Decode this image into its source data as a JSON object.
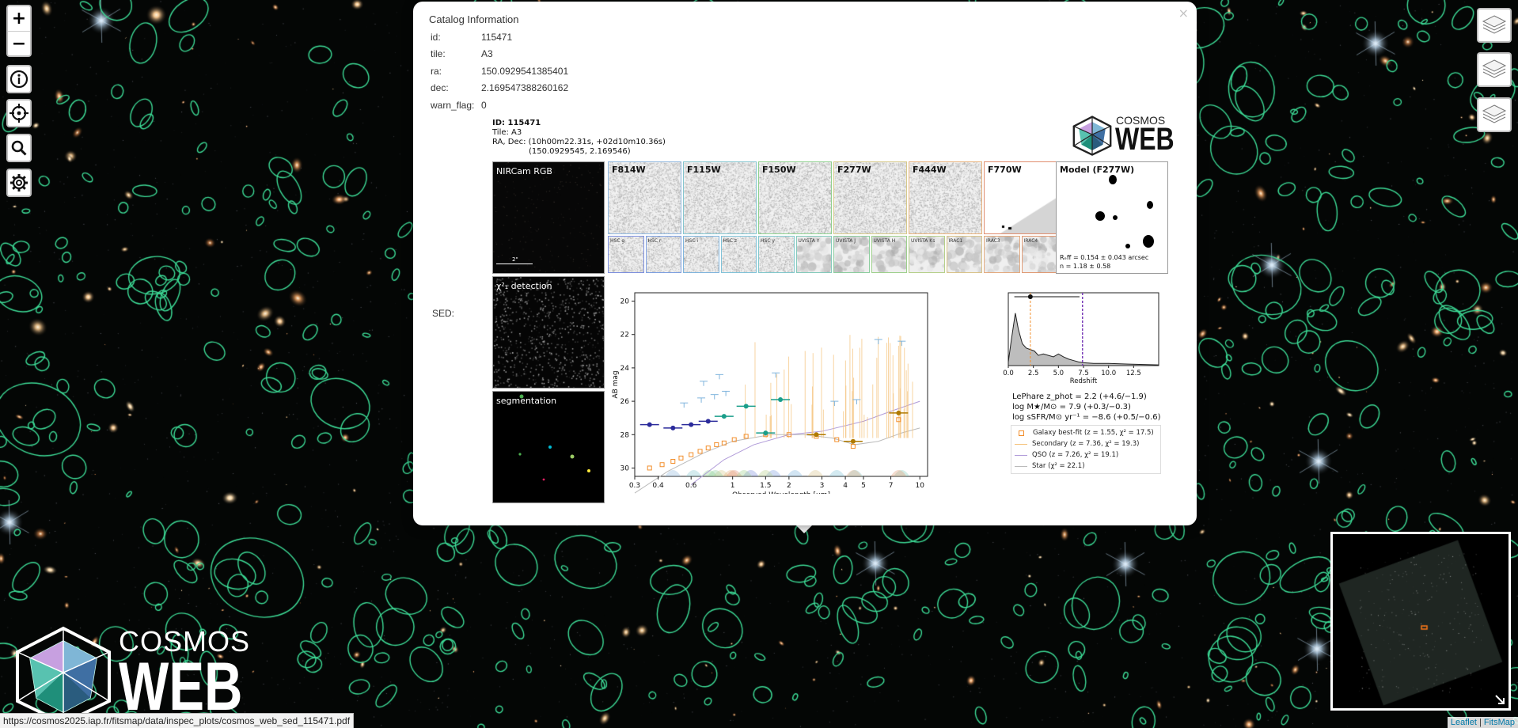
{
  "map": {
    "zoom_in": "+",
    "zoom_out": "−",
    "status_url": "https://cosmos2025.iap.fr/fitsmap/data/inspec_plots/cosmos_web_sed_115471.pdf",
    "attribution_sep": "|",
    "attribution_leaflet": "Leaflet",
    "attribution_fitsmap": "FitsMap",
    "logo_top": "COSMOS",
    "logo_bottom": "WEB"
  },
  "popup": {
    "title": "Catalog Information",
    "fields": [
      {
        "key": "id:",
        "value": "115471"
      },
      {
        "key": "tile:",
        "value": "A3"
      },
      {
        "key": "ra:",
        "value": "150.0929541385401"
      },
      {
        "key": "dec:",
        "value": "2.169547388260162"
      },
      {
        "key": "warn_flag:",
        "value": "0"
      }
    ],
    "sed_label": "SED:",
    "close": "×"
  },
  "inspect": {
    "header": {
      "id_line": "ID: 115471",
      "tile_line": "Tile: A3",
      "radec_line": "RA, Dec: (10h00m22.31s, +02d10m10.36s)",
      "radec_deg": "(150.0929545, 2.169546)"
    },
    "logo_top": "COSMOS",
    "logo_bottom": "WEB",
    "rgb_label": "NIRCam RGB",
    "scale_label": "2\"",
    "chi2_label": "χ²₁ detection",
    "seg_label": "segmentation",
    "bands": [
      {
        "label": "F814W",
        "color": "#8fb6dd"
      },
      {
        "label": "F115W",
        "color": "#84c5cf"
      },
      {
        "label": "F150W",
        "color": "#8fd08f"
      },
      {
        "label": "F277W",
        "color": "#d6c98a"
      },
      {
        "label": "F444W",
        "color": "#e8b27c"
      },
      {
        "label": "F770W",
        "color": "#e08d6f"
      }
    ],
    "model_label": "Model (F277W)",
    "model_stats": {
      "line1": "Rₑff = 0.154 ± 0.043 arcsec",
      "line2": "n = 1.18 ± 0.58"
    },
    "small_bands": [
      {
        "label": "HSC g",
        "color": "#7d8fdd"
      },
      {
        "label": "HSC r",
        "color": "#7d9fe0"
      },
      {
        "label": "HSC i",
        "color": "#7fb4dd"
      },
      {
        "label": "HSC z",
        "color": "#80c2d8"
      },
      {
        "label": "HSC y",
        "color": "#82c8cc"
      },
      {
        "label": "UVISTA Y",
        "color": "#84cabb"
      },
      {
        "label": "UVISTA J",
        "color": "#8ccd9e"
      },
      {
        "label": "UVISTA H",
        "color": "#9ed08c"
      },
      {
        "label": "UVISTA Ks",
        "color": "#b6d08a"
      },
      {
        "label": "IRAC1",
        "color": "#d9c38a"
      },
      {
        "label": "IRAC3",
        "color": "#e3aa7f"
      },
      {
        "label": "IRAC4",
        "color": "#e09a74"
      }
    ]
  },
  "chart_data": [
    {
      "type": "scatter",
      "title": "",
      "xlabel": "Observed Wavelength [μm]",
      "ylabel": "AB mag",
      "xscale": "log",
      "xlim": [
        0.3,
        11
      ],
      "ylim": [
        30.5,
        19.5
      ],
      "xticks": [
        0.3,
        0.4,
        0.6,
        1,
        1.5,
        2,
        3,
        4,
        5,
        7,
        10
      ],
      "yticks": [
        20,
        22,
        24,
        26,
        28,
        30
      ],
      "series": [
        {
          "name": "Galaxy best-fit (z = 1.55, χ² = 17.5)",
          "color": "#f28e2b",
          "x": [
            0.36,
            0.42,
            0.48,
            0.53,
            0.6,
            0.67,
            0.74,
            0.82,
            0.9,
            1.02,
            1.18,
            1.5,
            2.0,
            2.8,
            3.6,
            4.4,
            7.7
          ],
          "y": [
            30.0,
            29.8,
            29.6,
            29.4,
            29.2,
            29.0,
            28.8,
            28.6,
            28.5,
            28.3,
            28.1,
            28.0,
            28.0,
            28.1,
            28.3,
            28.7,
            27.1
          ]
        },
        {
          "name": "Secondary (z = 7.36, χ² = 19.3)",
          "color": "#f5c27a",
          "x": [],
          "y": []
        },
        {
          "name": "QSO (z = 7.26, χ² = 19.1)",
          "color": "#b19cd9",
          "x": [],
          "y": []
        },
        {
          "name": "Star (χ² = 22.1)",
          "color": "#bbbbbb",
          "x": [],
          "y": []
        },
        {
          "name": "",
          "color": "#2b2b9b",
          "x": [
            0.36,
            0.48,
            0.6,
            0.74
          ],
          "y": [
            27.4,
            27.6,
            27.4,
            27.2
          ]
        },
        {
          "name": "",
          "color": "#1a9e8a",
          "x": [
            0.9,
            1.18,
            1.5,
            1.8
          ],
          "y": [
            26.9,
            26.3,
            27.9,
            25.9
          ]
        },
        {
          "name": "",
          "color": "#b07a00",
          "x": [
            2.8,
            4.4,
            7.7
          ],
          "y": [
            28.0,
            28.4,
            26.7
          ]
        }
      ]
    },
    {
      "type": "area",
      "title": "",
      "xlabel": "Redshift",
      "ylabel": "",
      "xlim": [
        0,
        15
      ],
      "xticks": [
        0.0,
        2.5,
        5.0,
        7.5,
        10.0,
        12.5
      ],
      "series": [
        {
          "name": "",
          "x": [
            0,
            0.3,
            0.7,
            1.0,
            1.4,
            1.8,
            2.2,
            2.6,
            3.0,
            3.5,
            4.0,
            4.5,
            5.0,
            5.5,
            6.0,
            6.5,
            7.0,
            7.5,
            8.5,
            10,
            12,
            15
          ],
          "y": [
            0.05,
            0.35,
            0.72,
            0.5,
            0.3,
            0.24,
            0.22,
            0.2,
            0.14,
            0.16,
            0.14,
            0.12,
            0.16,
            0.12,
            0.09,
            0.07,
            0.05,
            0.04,
            0.03,
            0.03,
            0.02,
            0.01
          ]
        }
      ],
      "zphot": 2.2,
      "zsecondary": 7.4,
      "interval": [
        0.6,
        7.1
      ]
    }
  ],
  "sed_stats": {
    "zphot": "LePhare z_phot = 2.2 (+4.6/−1.9)",
    "mass": "log M★/M⊙ = 7.9 (+0.3/−0.3)",
    "ssfr": "log sSFR/M⊙ yr⁻¹ = −8.6 (+0.5/−0.6)"
  }
}
